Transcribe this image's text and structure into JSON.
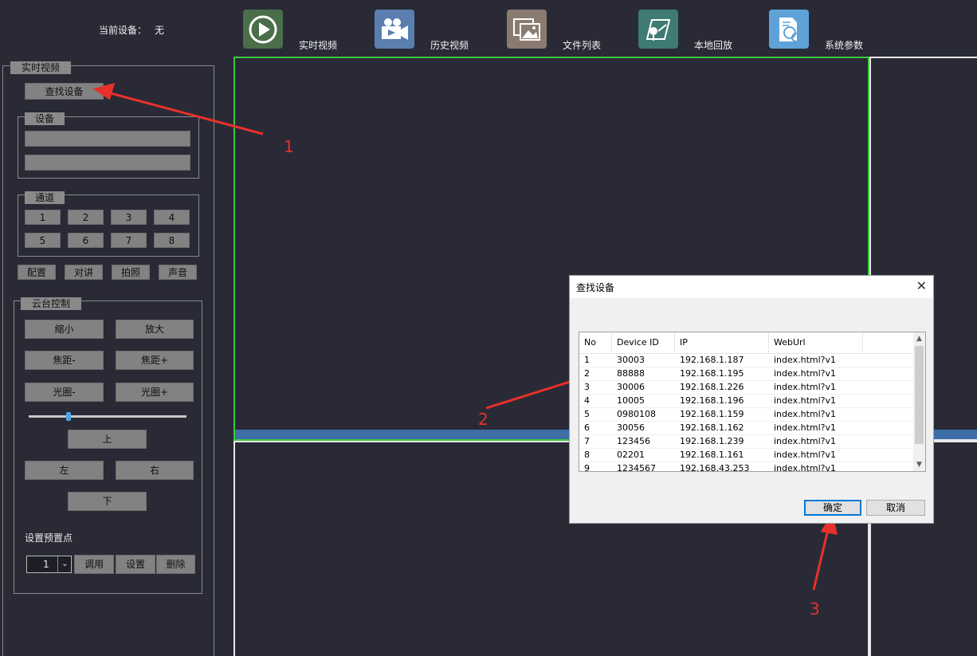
{
  "header": {
    "current_device_label": "当前设备：",
    "current_device_value": "无",
    "buttons": [
      {
        "label": "实时视频",
        "icon": "play-icon",
        "color": "#4a6e4a"
      },
      {
        "label": "历史视频",
        "icon": "video-camera-icon",
        "color": "#5a7fae"
      },
      {
        "label": "文件列表",
        "icon": "photos-icon",
        "color": "#8a7a70"
      },
      {
        "label": "本地回放",
        "icon": "map-pin-icon",
        "color": "#3f7a74"
      },
      {
        "label": "系统参数",
        "icon": "settings-doc-icon",
        "color": "#5fa2d8"
      }
    ]
  },
  "left": {
    "panel_title": "实时视频",
    "find_device": "查找设备",
    "device_group": "设备",
    "channel_group": "通道",
    "channels": [
      "1",
      "2",
      "3",
      "4",
      "5",
      "6",
      "7",
      "8"
    ],
    "actions": [
      "配置",
      "对讲",
      "拍照",
      "声音"
    ],
    "ptz_group": "云台控制",
    "zoom_out": "缩小",
    "zoom_in": "放大",
    "focus_minus": "焦距-",
    "focus_plus": "焦距+",
    "iris_minus": "光圈-",
    "iris_plus": "光圈+",
    "slider_value": 0.25,
    "up": "上",
    "left": "左",
    "right": "右",
    "down": "下",
    "preset_label": "设置预置点",
    "preset_value": "1",
    "call": "调用",
    "set": "设置",
    "delete": "删除"
  },
  "dialog": {
    "title": "查找设备",
    "close": "✕",
    "columns": [
      "No",
      "Device ID",
      "IP",
      "WebUrl"
    ],
    "rows": [
      [
        "1",
        "30003",
        "192.168.1.187",
        "index.html?v1"
      ],
      [
        "2",
        "88888",
        "192.168.1.195",
        "index.html?v1"
      ],
      [
        "3",
        "30006",
        "192.168.1.226",
        "index.html?v1"
      ],
      [
        "4",
        "10005",
        "192.168.1.196",
        "index.html?v1"
      ],
      [
        "5",
        "0980108",
        "192.168.1.159",
        "index.html?v1"
      ],
      [
        "6",
        "30056",
        "192.168.1.162",
        "index.html?v1"
      ],
      [
        "7",
        "123456",
        "192.168.1.239",
        "index.html?v1"
      ],
      [
        "8",
        "02201",
        "192.168.1.161",
        "index.html?v1"
      ],
      [
        "9",
        "1234567",
        "192.168.43.253",
        "index.html?v1"
      ]
    ],
    "ok": "确定",
    "cancel": "取消"
  },
  "annotations": [
    "1",
    "2",
    "3"
  ]
}
